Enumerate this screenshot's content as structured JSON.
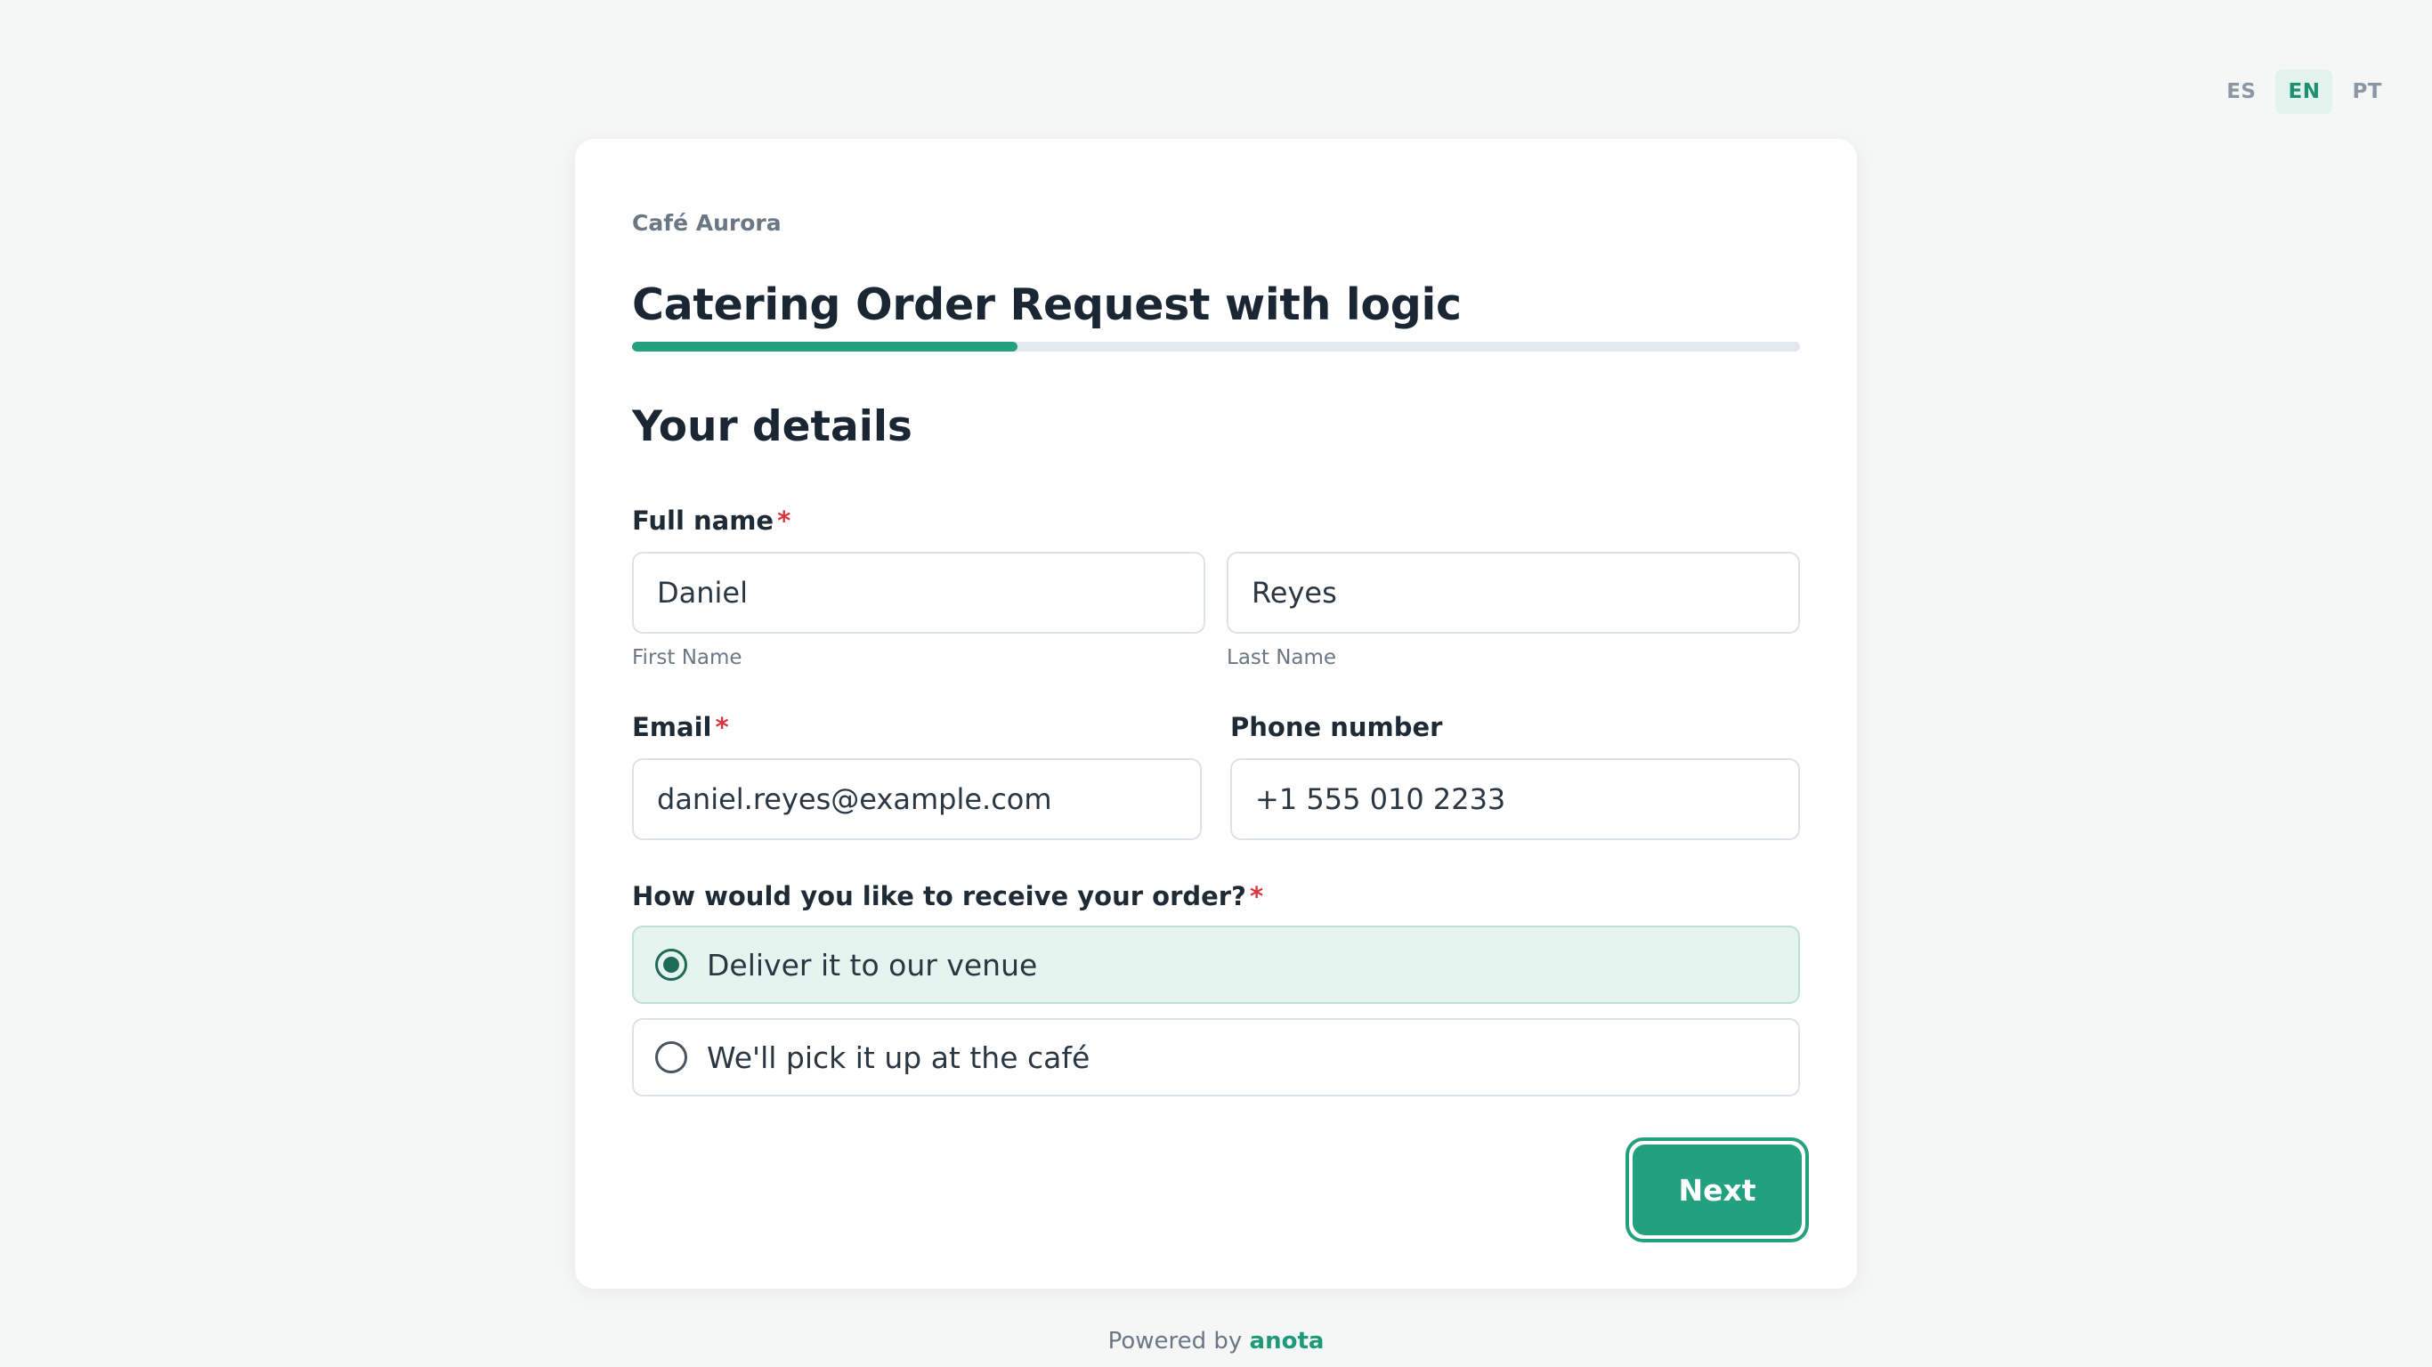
{
  "languages": [
    {
      "code": "ES",
      "active": false
    },
    {
      "code": "EN",
      "active": true
    },
    {
      "code": "PT",
      "active": false
    }
  ],
  "form": {
    "brand": "Café Aurora",
    "title": "Catering Order Request with logic",
    "progress_fraction": 0.33,
    "section_title": "Your details"
  },
  "fields": {
    "full_name": {
      "label": "Full name",
      "required_mark": "*",
      "first_value": "Daniel",
      "first_sublabel": "First Name",
      "last_value": "Reyes",
      "last_sublabel": "Last Name"
    },
    "email": {
      "label": "Email",
      "required_mark": "*",
      "value": "daniel.reyes@example.com"
    },
    "phone": {
      "label": "Phone number",
      "value": "+1 555 010 2233"
    },
    "receive": {
      "label": "How would you like to receive your order?",
      "required_mark": "*",
      "options": [
        {
          "label": "Deliver it to our venue",
          "selected": true
        },
        {
          "label": "We'll pick it up at the café",
          "selected": false
        }
      ]
    }
  },
  "actions": {
    "next_label": "Next"
  },
  "footer": {
    "powered_prefix": "Powered by",
    "powered_brand": "anota"
  },
  "colors": {
    "accent": "#23a17e",
    "required": "#d9363e",
    "selected_bg": "#e6f4ef"
  }
}
